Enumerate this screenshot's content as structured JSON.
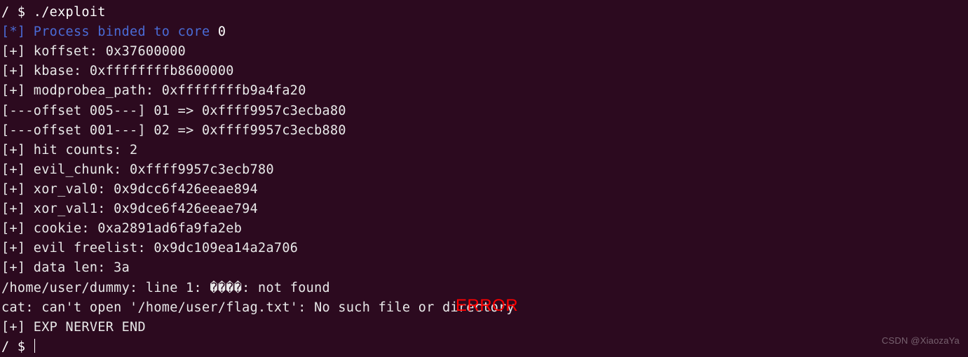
{
  "prompt1": "/ $ ",
  "cmd1": "./exploit",
  "blue_line_prefix": "[*] Process binded to core",
  "blue_line_suffix": " 0",
  "lines": {
    "l1": "[+] koffset: 0x37600000",
    "l2": "[+] kbase: 0xffffffffb8600000",
    "l3": "[+] modprobea_path: 0xffffffffb9a4fa20",
    "l4": "[---offset 005---] 01 => 0xffff9957c3ecba80",
    "l5": "[---offset 001---] 02 => 0xffff9957c3ecb880",
    "l6": "[+] hit counts: 2",
    "l7": "[+] evil_chunk: 0xffff9957c3ecb780",
    "l8": "[+] xor_val0: 0x9dcc6f426eeae894",
    "l9": "[+] xor_val1: 0x9dce6f426eeae794",
    "l10": "[+] cookie: 0xa2891ad6fa9fa2eb",
    "l11": "[+] evil freelist: 0x9dc109ea14a2a706",
    "l12": "[+] data len: 3a",
    "l13": "/home/user/dummy: line 1: ����: not found",
    "l14": "cat: can't open '/home/user/flag.txt': No such file or directory",
    "l15": "[+] EXP NERVER END"
  },
  "prompt2": "/ $ ",
  "error_overlay": "ERROR",
  "watermark": "CSDN @XiaozaYa"
}
